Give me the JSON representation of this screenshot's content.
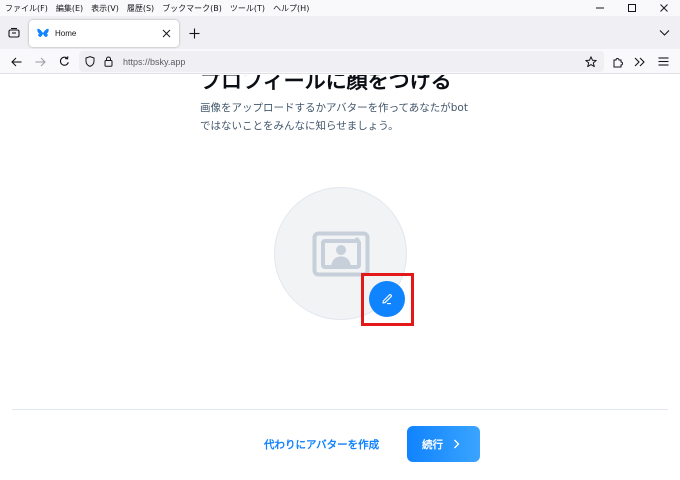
{
  "menubar": {
    "items": [
      "ファイル(F)",
      "編集(E)",
      "表示(V)",
      "履歴(S)",
      "ブックマーク(B)",
      "ツール(T)",
      "ヘルプ(H)"
    ]
  },
  "tabs": [
    {
      "title": "Home",
      "favicon": "butterfly-icon"
    }
  ],
  "urlbar": {
    "url": "https://bsky.app"
  },
  "page": {
    "title": "プロフィールに顔をつける",
    "description_line1": "画像をアップロードするかアバターを作ってあなたがbot",
    "description_line2": "ではないことをみんなに知らせましょう。",
    "create_avatar_label": "代わりにアバターを作成",
    "continue_label": "続行"
  },
  "colors": {
    "accent": "#1083fe",
    "highlight": "#e31919"
  }
}
